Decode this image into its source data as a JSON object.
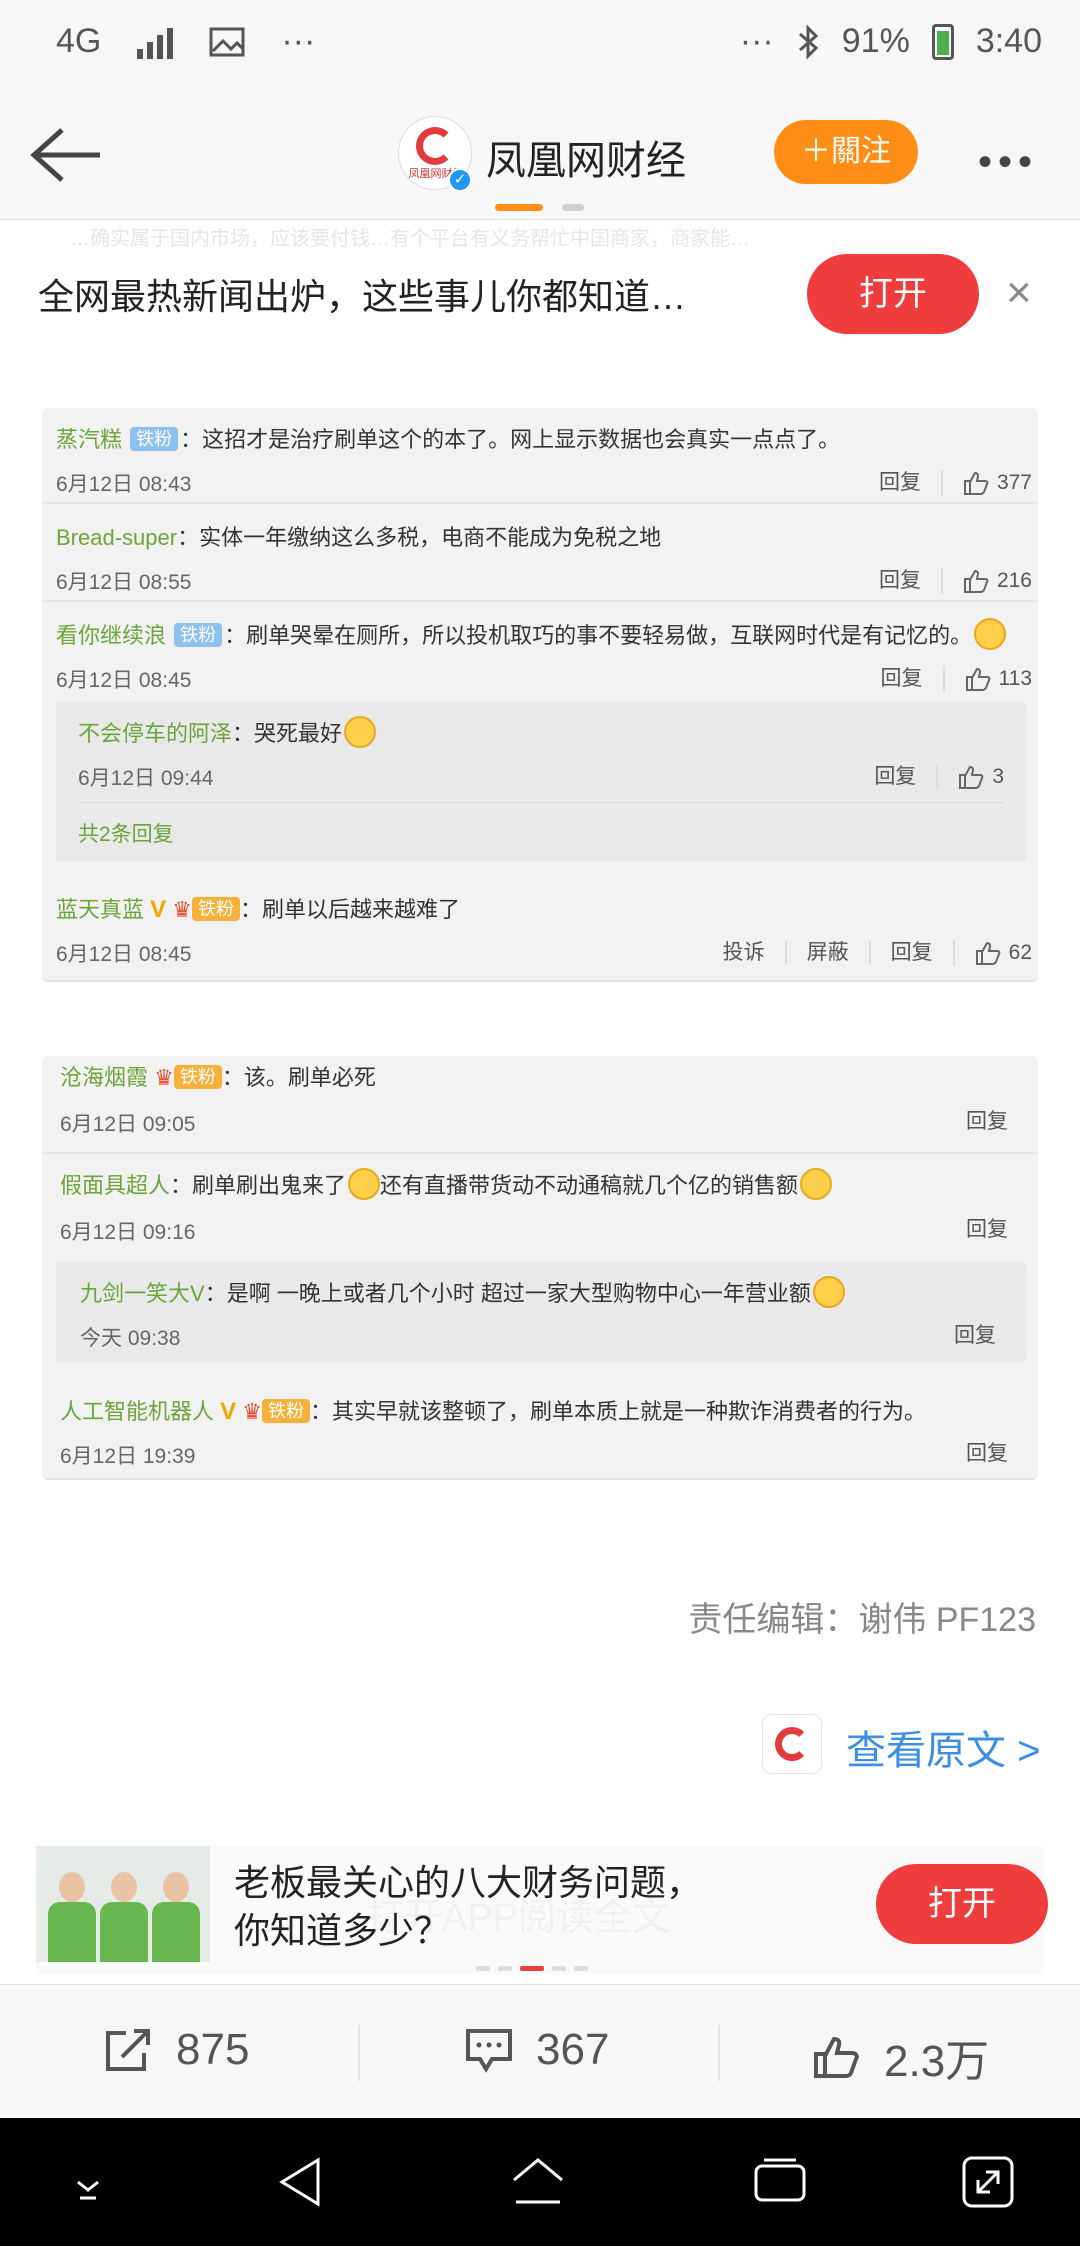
{
  "status_bar": {
    "network": "4G",
    "more": "···",
    "more_right": "···",
    "battery": "91%",
    "time": "3:40"
  },
  "header": {
    "logo_text": "凤凰网财经",
    "title": "凤凰网财经",
    "follow_label": "＋關注"
  },
  "banner": {
    "ghost_text": "…确实属于国内市场，应该要付钱…有个平台有义务帮忙中国商家，商家能…",
    "text": "全网最热新闻出炉，这些事儿你都知道…",
    "open_label": "打开",
    "close": "×"
  },
  "card1": {
    "comments": [
      {
        "user": "蒸汽糕",
        "badge": "铁粉",
        "text": "：这招才是治疗刷单这个的本了。网上显示数据也会真实一点点了。",
        "time": "6月12日 08:43",
        "actions": [
          "回复"
        ],
        "likes": "377"
      },
      {
        "user": "Bread-super",
        "text": "：实体一年缴纳这么多税，电商不能成为免税之地",
        "time": "6月12日 08:55",
        "actions": [
          "回复"
        ],
        "likes": "216"
      },
      {
        "user": "看你继续浪",
        "badge": "铁粉",
        "text": "：刷单哭晕在厕所，所以投机取巧的事不要轻易做，互联网时代是有记忆的。",
        "time": "6月12日 08:45",
        "actions": [
          "回复"
        ],
        "likes": "113"
      }
    ],
    "reply": {
      "user": "不会停车的阿泽",
      "text": "：哭死最好",
      "time": "6月12日 09:44",
      "action": "回复",
      "likes": "3",
      "more": "共2条回复"
    },
    "last": {
      "user": "蓝天真蓝",
      "crown_level": "6",
      "badge": "铁粉",
      "text": "：刷单以后越来越难了",
      "time": "6月12日 08:45",
      "actions": [
        "投诉",
        "屏蔽",
        "回复"
      ],
      "likes": "62"
    }
  },
  "card2": {
    "comments": [
      {
        "user": "沧海烟霞",
        "crown_level": "3",
        "badge": "铁粉",
        "text": "：该。刷单必死",
        "time": "6月12日 09:05",
        "action": "回复"
      },
      {
        "user": "假面具超人",
        "text": "：刷单刷出鬼来了",
        "text2": "还有直播带货动不动通稿就几个亿的销售额",
        "time": "6月12日 09:16",
        "action": "回复"
      }
    ],
    "reply": {
      "user": "九剑一笑大V",
      "text": "：是啊 一晚上或者几个小时 超过一家大型购物中心一年营业额",
      "time": "今天 09:38",
      "action": "回复"
    },
    "last": {
      "user": "人工智能机器人",
      "crown_level": "6",
      "badge": "铁粉",
      "text": "：其实早就该整顿了，刷单本质上就是一种欺诈消费者的行为。",
      "time": "6月12日 19:39",
      "action": "回复"
    }
  },
  "editor": "责任编辑：谢伟 PF123",
  "source_link": "查看原文 >",
  "ad": {
    "title_line1": "老板最关心的八大财务问题，",
    "title_line2": "你知道多少？",
    "ghost_text": "打开APP阅读全文",
    "open_label": "打开"
  },
  "bottom_bar": {
    "share_count": "875",
    "comment_count": "367",
    "like_count": "2.3万"
  },
  "colors": {
    "accent_orange": "#ff8e16",
    "open_red": "#ef3d3d",
    "username_green": "#6aa43a",
    "link_blue": "#3b8ee3"
  }
}
